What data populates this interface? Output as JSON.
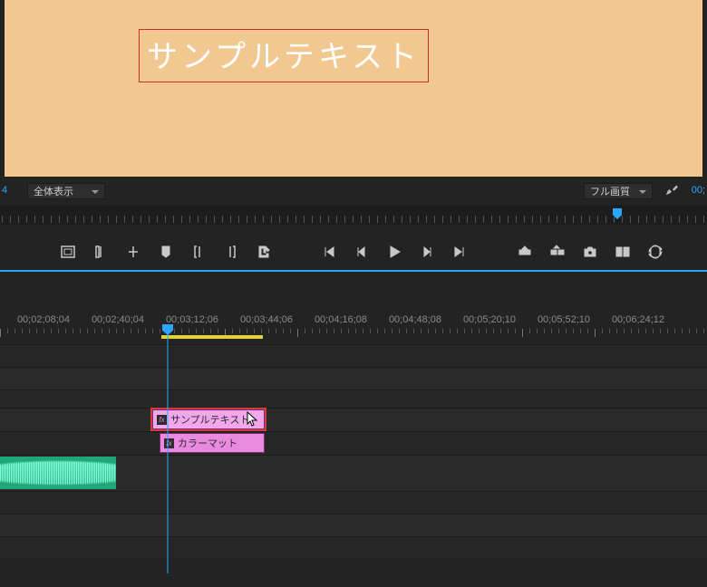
{
  "preview": {
    "sample_text": "サンプルテキスト"
  },
  "ctrl": {
    "left_num": "4",
    "fit_label": "全体表示",
    "quality_label": "フル画質",
    "right_num": "00;"
  },
  "timecodes": [
    "00;02;08;04",
    "00;02;40;04",
    "00;03;12;06",
    "00;03;44;06",
    "00;04;16;08",
    "00;04;48;08",
    "00;05;20;10",
    "00;05;52;10",
    "00;06;24;12"
  ],
  "clips": {
    "title_clip_label": "サンプルテキスト",
    "matte_clip_label": "カラーマット"
  }
}
